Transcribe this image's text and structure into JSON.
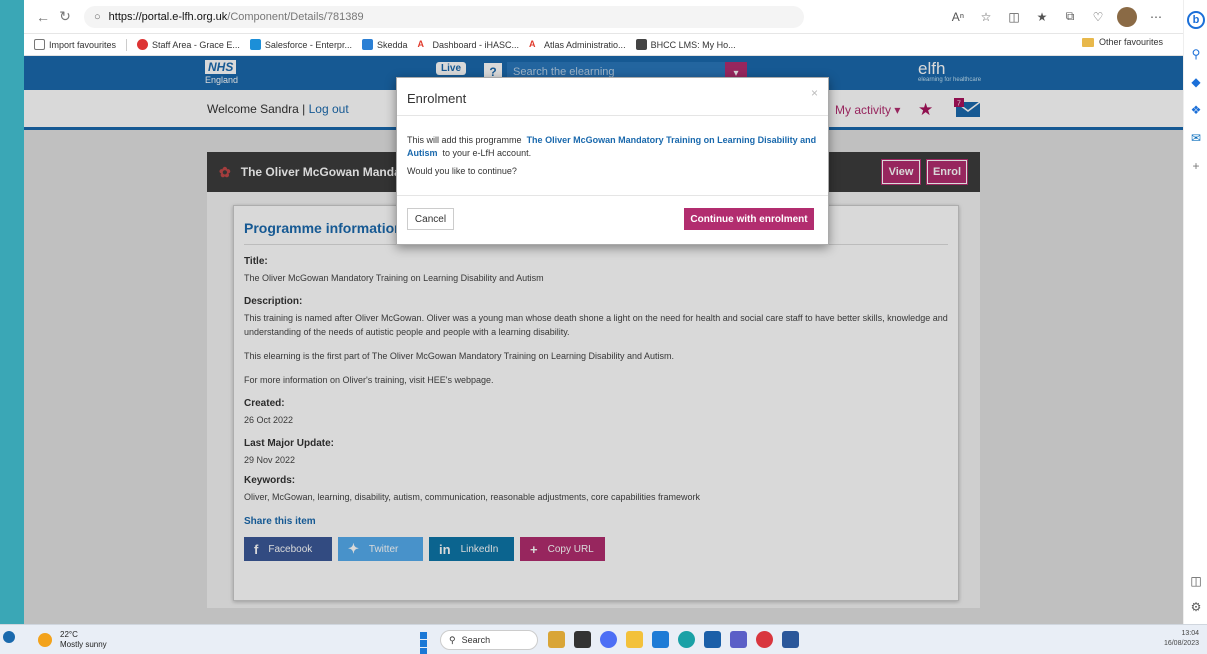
{
  "browser": {
    "url_host": "https://portal.e-lfh.org.uk",
    "url_path": "/Component/Details/781389"
  },
  "favourites": [
    {
      "label": "Import favourites",
      "color": "#777"
    },
    {
      "label": "Staff Area - Grace E...",
      "color": "#d33"
    },
    {
      "label": "Salesforce - Enterpr...",
      "color": "#1c8fd8"
    },
    {
      "label": "Skedda",
      "color": "#2b7fd4"
    },
    {
      "label": "Dashboard - iHASC...",
      "color": "#e03a2c"
    },
    {
      "label": "Atlas Administratio...",
      "color": "#e03a2c"
    },
    {
      "label": "BHCC LMS: My Ho...",
      "color": "#444"
    }
  ],
  "other_favourites": "Other favourites",
  "site": {
    "nhs": "NHS",
    "england": "England",
    "live": "Live",
    "help": "?",
    "search_placeholder": "Search the elearning",
    "elfh": "elfh",
    "elfh_sub": "elearning for healthcare",
    "welcome": "Welcome Sandra",
    "logout": "Log out",
    "my_activity": "My activity ▾"
  },
  "programme": {
    "title": "The Oliver McGowan Mandato",
    "view": "View",
    "enrol": "Enrol"
  },
  "card": {
    "heading": "Programme information",
    "title_label": "Title:",
    "title_value": "The Oliver McGowan Mandatory Training on Learning Disability and Autism",
    "desc_label": "Description:",
    "desc_1": "This training is named after Oliver McGowan. Oliver was a young man whose death shone a light on the need for health and social care staff to have better skills, knowledge and understanding of the needs of autistic people and people with a learning disability.",
    "desc_2": "This elearning is the first part of The Oliver McGowan Mandatory Training on Learning Disability and Autism.",
    "desc_3": "For more information on Oliver's training, visit HEE's webpage.",
    "created_label": "Created:",
    "created_value": "26 Oct 2022",
    "update_label": "Last Major Update:",
    "update_value": "29 Nov 2022",
    "keywords_label": "Keywords:",
    "keywords_value": "Oliver, McGowan, learning, disability, autism, communication, reasonable adjustments, core capabilities framework",
    "share_label": "Share this item",
    "share_buttons": [
      {
        "label": "Facebook",
        "icon": "f",
        "color": "#3b5998"
      },
      {
        "label": "Twitter",
        "icon": "❧",
        "color": "#55acee"
      },
      {
        "label": "LinkedIn",
        "icon": "in",
        "color": "#0e76a8"
      },
      {
        "label": "Copy URL",
        "icon": "+",
        "color": "#b22d6f"
      }
    ]
  },
  "modal": {
    "title": "Enrolment",
    "close": "×",
    "text_before": "This will add this programme",
    "programme_name": "The Oliver McGowan Mandatory Training on Learning Disability and Autism",
    "text_after": "to your e-LfH account.",
    "question": "Would you like to continue?",
    "cancel": "Cancel",
    "continue": "Continue with enrolment"
  },
  "taskbar": {
    "temp": "22°C",
    "weather": "Mostly sunny",
    "search": "Search",
    "time": "13:04",
    "date": "16/08/2023"
  }
}
